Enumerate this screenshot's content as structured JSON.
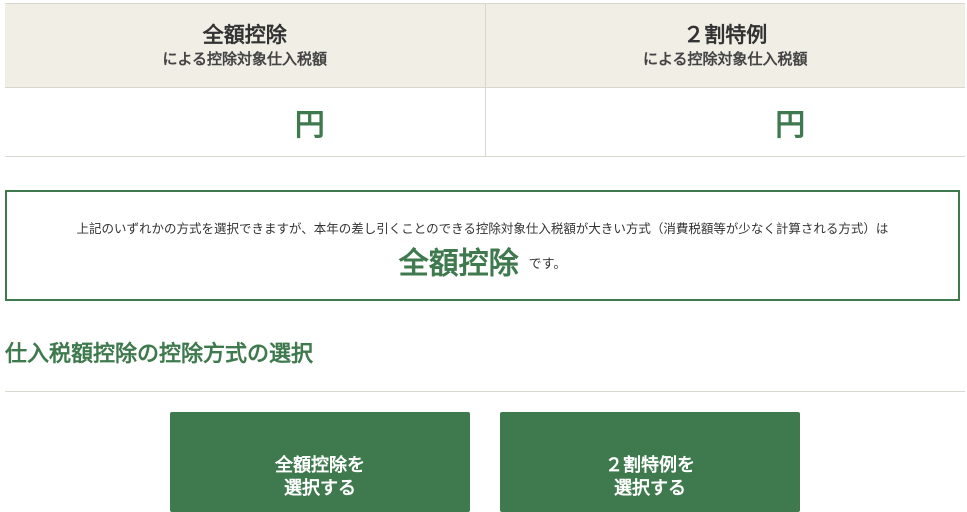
{
  "comparison": {
    "columns": [
      {
        "title": "全額控除",
        "subtitle": "による控除対象仕入税額",
        "amount": "",
        "unit": "円"
      },
      {
        "title": "２割特例",
        "subtitle": "による控除対象仕入税額",
        "amount": "",
        "unit": "円"
      }
    ]
  },
  "result": {
    "text": "上記のいずれかの方式を選択できますが、本年の差し引くことのできる控除対象仕入税額が大きい方式（消費税額等が少なく計算される方式）は",
    "method": "全額控除",
    "suffix": "です。"
  },
  "selection": {
    "title": "仕入税額控除の控除方式の選択",
    "buttons": [
      {
        "line1": "全額控除を",
        "line2": "選択する"
      },
      {
        "line1": "２割特例を",
        "line2": "選択する"
      }
    ]
  },
  "colors": {
    "accent": "#3f7a4e",
    "header_bg": "#f1eee6"
  }
}
